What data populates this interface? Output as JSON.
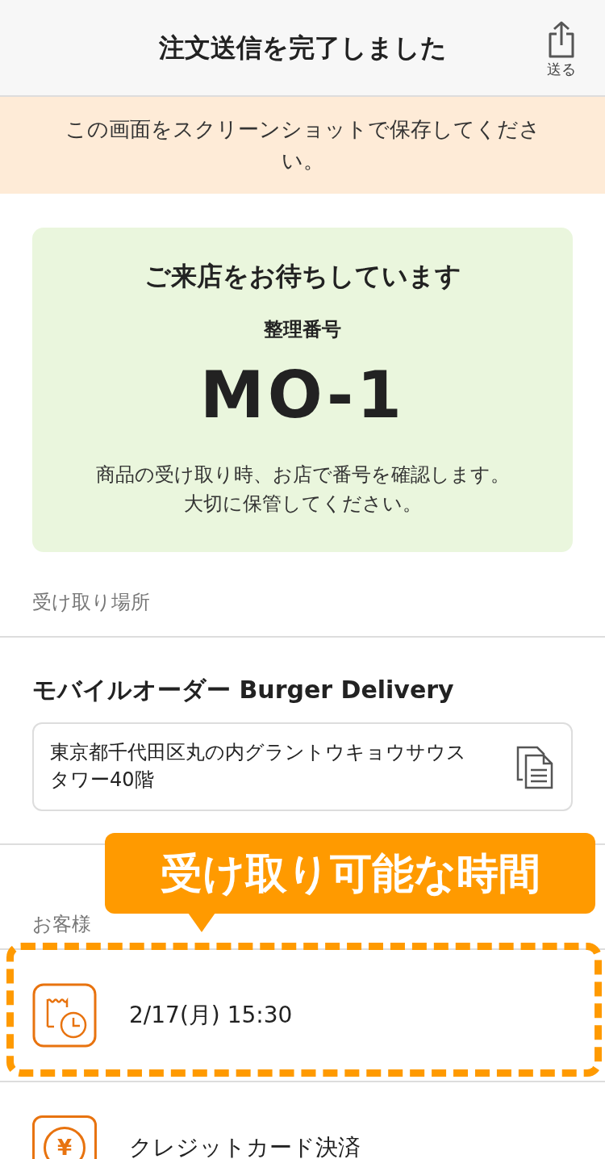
{
  "header": {
    "title": "注文送信を完了しました",
    "share_label": "送る"
  },
  "notice": "この画面をスクリーンショットで保存してください。",
  "ticket": {
    "heading": "ご来店をお待ちしています",
    "number_label": "整理番号",
    "number": "MO-1",
    "note_lines": [
      "商品の受け取り時、お店で番号を確認します。",
      "大切に保管してください。"
    ]
  },
  "pickup_section": {
    "label": "受け取り場所",
    "store_name": "モバイルオーダー Burger Delivery",
    "address": "東京都千代田区丸の内グラントウキョウサウスタワー40階"
  },
  "customer_section": {
    "label": "お客様"
  },
  "rows": [
    {
      "kind": "time",
      "text": "2/17(月) 15:30"
    },
    {
      "kind": "payment",
      "text": "クレジットカード決済",
      "symbol": "¥"
    }
  ],
  "callout": {
    "text": "受け取り可能な時間"
  }
}
